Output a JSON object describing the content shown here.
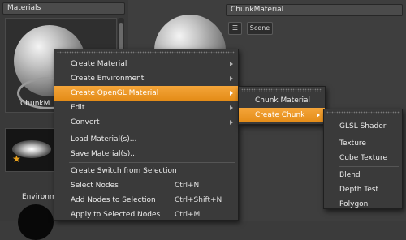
{
  "left_panel": {
    "search_value": "Materials",
    "thumb1_label": "ChunkM",
    "thumb2_label": "Environm"
  },
  "right_panel": {
    "name_field": "ChunkMaterial",
    "scene_button": "Scene"
  },
  "context_menu": {
    "items": [
      {
        "label": "Create Material",
        "submenu": true
      },
      {
        "label": "Create Environment",
        "submenu": true
      },
      {
        "label": "Create OpenGL Material",
        "submenu": true,
        "highlighted": true
      },
      {
        "label": "Edit",
        "submenu": true
      },
      {
        "label": "Convert",
        "submenu": true
      },
      {
        "label": "Load Material(s)..."
      },
      {
        "label": "Save Material(s)..."
      },
      {
        "label": "Create Switch from Selection"
      },
      {
        "label": "Select Nodes",
        "shortcut": "Ctrl+N"
      },
      {
        "label": "Add Nodes to Selection",
        "shortcut": "Ctrl+Shift+N"
      },
      {
        "label": "Apply to Selected Nodes",
        "shortcut": "Ctrl+M"
      }
    ]
  },
  "opengl_submenu": {
    "items": [
      {
        "label": "Chunk Material"
      },
      {
        "label": "Create Chunk",
        "submenu": true,
        "highlighted": true
      }
    ]
  },
  "chunk_submenu": {
    "items": [
      {
        "label": "GLSL Shader"
      },
      {
        "label": "Texture"
      },
      {
        "label": "Cube Texture"
      },
      {
        "label": "Blend"
      },
      {
        "label": "Depth Test"
      },
      {
        "label": "Polygon"
      }
    ]
  }
}
